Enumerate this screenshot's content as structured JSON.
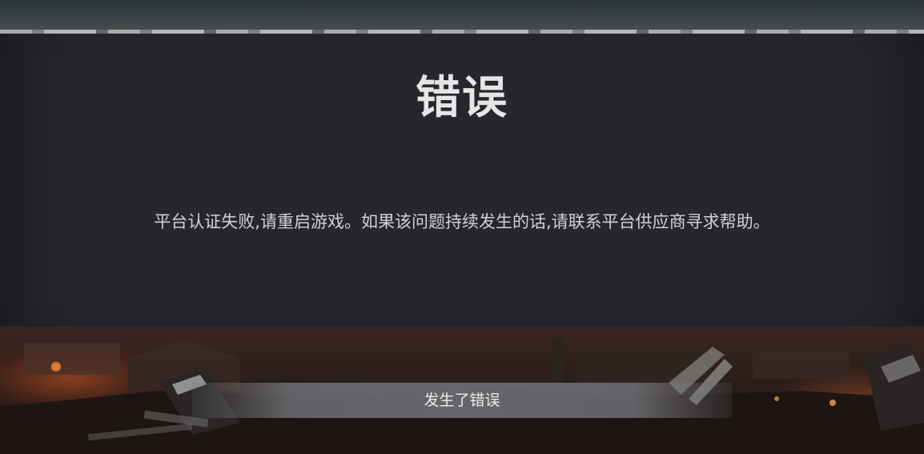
{
  "dialog": {
    "title": "错误",
    "message": "平台认证失败,请重启游戏。如果该问题持续发生的话,请联系平台供应商寻求帮助。"
  },
  "status_bar": {
    "text": "发生了错误"
  },
  "colors": {
    "dialog_bg": "#26272c",
    "title_text": "#e6e6e6",
    "message_text": "#d2d2d2",
    "status_bar": "#78797f"
  }
}
